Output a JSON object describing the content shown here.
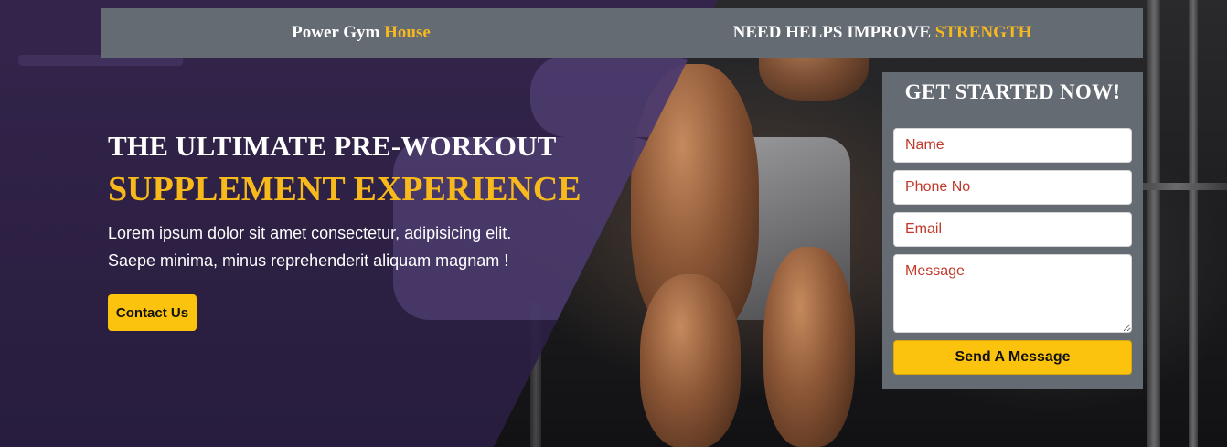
{
  "topbar": {
    "brand_main": "Power Gym ",
    "brand_accent": "House",
    "tagline_main": "NEED HELPS IMPROVE ",
    "tagline_accent": "STRENGTH"
  },
  "hero": {
    "headline": "THE ULTIMATE PRE-WORKOUT",
    "subheadline": "SUPPLEMENT EXPERIENCE",
    "description_line1": "Lorem ipsum dolor sit amet consectetur, adipisicing elit.",
    "description_line2": "Saepe minima, minus reprehenderit aliquam magnam !",
    "contact_button": "Contact Us"
  },
  "form": {
    "title": "GET STARTED NOW!",
    "name_placeholder": "Name",
    "phone_placeholder": "Phone No",
    "email_placeholder": "Email",
    "message_placeholder": "Message",
    "submit_label": "Send A Message"
  },
  "colors": {
    "accent": "#f5b820",
    "button": "#fbc30e",
    "panel": "#656b73",
    "overlay": "#34244e",
    "placeholder": "#c0392b"
  }
}
